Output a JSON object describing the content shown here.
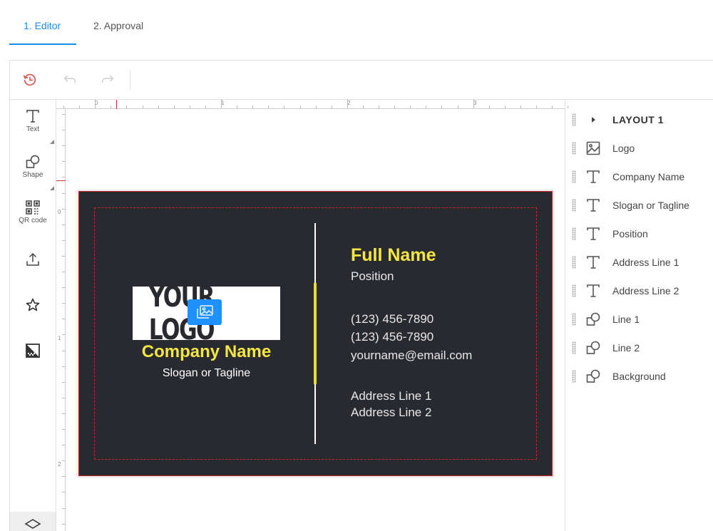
{
  "tabs": [
    {
      "label": "1. Editor",
      "active": true
    },
    {
      "label": "2. Approval",
      "active": false
    }
  ],
  "accent_color": "#1e88e5",
  "toolbar": {
    "history_icon": "history-icon",
    "undo_icon": "undo-icon",
    "redo_icon": "redo-icon"
  },
  "tools": [
    {
      "label": "Text",
      "icon": "text-icon"
    },
    {
      "label": "Shape",
      "icon": "shape-icon"
    },
    {
      "label": "QR code",
      "icon": "qr-code-icon"
    },
    {
      "label": "",
      "icon": "upload-icon"
    },
    {
      "label": "",
      "icon": "star-icon"
    },
    {
      "label": "",
      "icon": "background-pattern-icon"
    },
    {
      "label": "",
      "icon": "layers-icon"
    }
  ],
  "rulers": {
    "top_labels": [
      "0",
      "1",
      "2",
      "3"
    ],
    "left_labels": [
      "0",
      "1",
      "2"
    ]
  },
  "card": {
    "background_color": "#282a30",
    "accent_yellow": "#f5e642",
    "logo_text": "YOUR LOGO",
    "company_name": "Company Name",
    "slogan": "Slogan or Tagline",
    "full_name": "Full Name",
    "position": "Position",
    "phone1": "(123) 456-7890",
    "phone2": "(123) 456-7890",
    "email": "yourname@email.com",
    "address1": "Address Line 1",
    "address2": "Address Line 2"
  },
  "layers": {
    "title": "LAYOUT 1",
    "items": [
      {
        "label": "Logo",
        "icon": "image-icon"
      },
      {
        "label": "Company Name",
        "icon": "text-icon"
      },
      {
        "label": "Slogan or Tagline",
        "icon": "text-icon"
      },
      {
        "label": "Position",
        "icon": "text-icon"
      },
      {
        "label": "Address Line 1",
        "icon": "text-icon"
      },
      {
        "label": "Address Line 2",
        "icon": "text-icon"
      },
      {
        "label": "Line 1",
        "icon": "shape-icon"
      },
      {
        "label": "Line 2",
        "icon": "shape-icon"
      },
      {
        "label": "Background",
        "icon": "shape-icon"
      }
    ]
  }
}
